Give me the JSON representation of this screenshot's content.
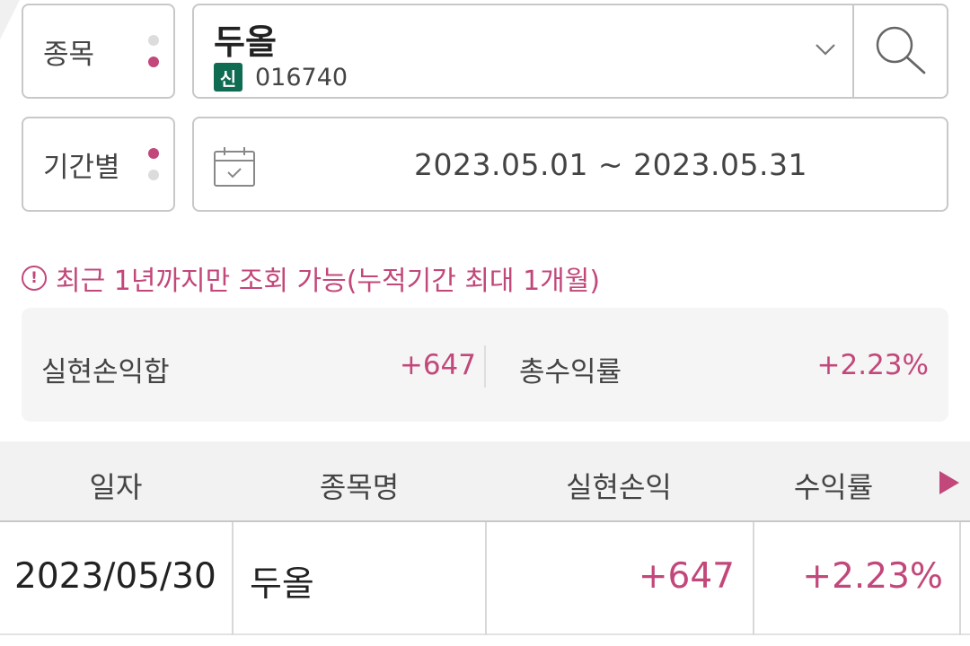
{
  "filters": {
    "stock_label": "종목",
    "period_label": "기간별",
    "stock_name": "두올",
    "credit_badge": "신",
    "stock_code": "016740",
    "date_range": "2023.05.01 ~ 2023.05.31"
  },
  "notice": {
    "icon": "!",
    "text": "최근 1년까지만 조회 가능(누적기간 최대 1개월)"
  },
  "summary": {
    "realized_pnl_label": "실현손익합",
    "realized_pnl_value": "+647",
    "total_return_label": "총수익률",
    "total_return_value": "+2.23%"
  },
  "table": {
    "headers": [
      "일자",
      "종목명",
      "실현손익",
      "수익률"
    ],
    "rows": [
      {
        "date": "2023/05/30",
        "name": "두올",
        "pnl": "+647",
        "return": "+2.23%"
      }
    ]
  },
  "colors": {
    "accent": "#c2477a",
    "credit_badge": "#0f6b52",
    "border": "#c8c8c8"
  },
  "icons": [
    "chevron-down-icon",
    "search-icon",
    "calendar-icon",
    "info-icon",
    "next-arrow-icon"
  ]
}
